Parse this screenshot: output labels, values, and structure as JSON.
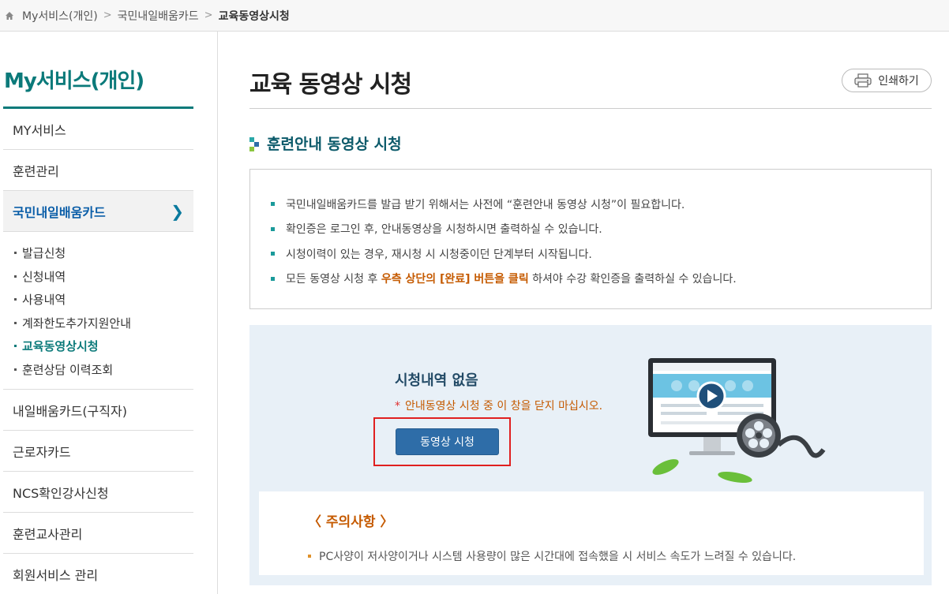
{
  "breadcrumb": {
    "items": [
      "My서비스(개인)",
      "국민내일배움카드",
      "교육동영상시청"
    ]
  },
  "sidebar": {
    "title": "My서비스(개인)",
    "items": [
      {
        "label": "MY서비스"
      },
      {
        "label": "훈련관리"
      },
      {
        "label": "국민내일배움카드",
        "active": true
      },
      {
        "label": "내일배움카드(구직자)"
      },
      {
        "label": "근로자카드"
      },
      {
        "label": "NCS확인강사신청"
      },
      {
        "label": "훈련교사관리"
      },
      {
        "label": "회원서비스 관리"
      }
    ],
    "subitems": [
      {
        "label": "발급신청"
      },
      {
        "label": "신청내역"
      },
      {
        "label": "사용내역"
      },
      {
        "label": "계좌한도추가지원안내"
      },
      {
        "label": "교육동영상시청",
        "active": true
      },
      {
        "label": "훈련상담 이력조회"
      }
    ]
  },
  "main": {
    "title": "교육 동영상 시청",
    "print_label": "인쇄하기",
    "section_title": "훈련안내 동영상 시청",
    "notices": [
      "국민내일배움카드를 발급 받기 위해서는 사전에 “훈련안내 동영상 시청”이 필요합니다.",
      "확인증은 로그인 후, 안내동영상을 시청하시면 출력하실 수 있습니다.",
      "시청이력이 있는 경우, 재시청 시 시청중이던 단계부터 시작됩니다."
    ],
    "notice4": {
      "before": "모든 동영상 시청 후 ",
      "highlight": "우측 상단의 [완료] 버튼을 클릭",
      "after": " 하셔야 수강 확인증을 출력하실 수 있습니다."
    },
    "status_title": "시청내역 없음",
    "warning_star": "*",
    "warning": "안내동영상 시청 중 이 창을 닫지 마십시오.",
    "watch_button": "동영상 시청",
    "caution_title": "〈 주의사항 〉",
    "caution_text": "PC사양이 저사양이거나 시스템 사용량이 많은 시간대에 접속했을 시 서비스 속도가 느려질 수 있습니다."
  },
  "colors": {
    "accent": "#0b7a7a",
    "highlight": "#c55a00",
    "button": "#2e6da8",
    "alert_border": "#e02020"
  }
}
